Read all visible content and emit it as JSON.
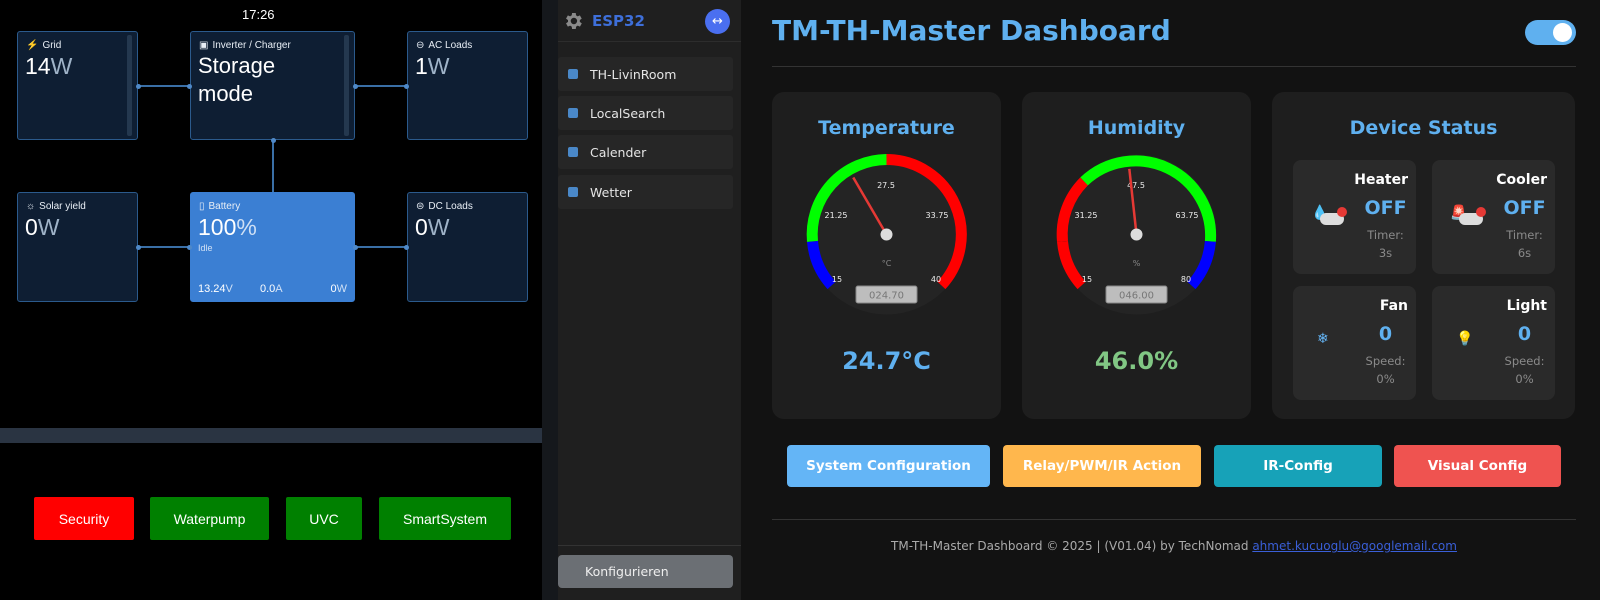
{
  "victron": {
    "clock": "17:26",
    "grid": {
      "label": "Grid",
      "value": "14",
      "unit": "W"
    },
    "inverter": {
      "label": "Inverter / Charger",
      "line1": "Storage",
      "line2": "mode"
    },
    "ac_loads": {
      "label": "AC Loads",
      "value": "1",
      "unit": "W"
    },
    "solar": {
      "label": "Solar yield",
      "value": "0",
      "unit": "W"
    },
    "battery": {
      "label": "Battery",
      "value": "100",
      "unit": "%",
      "state": "Idle",
      "voltage": "13.24",
      "voltage_unit": "V",
      "current": "0.0",
      "current_unit": "A",
      "power": "0",
      "power_unit": "W"
    },
    "dc_loads": {
      "label": "DC Loads",
      "value": "0",
      "unit": "W"
    },
    "buttons": [
      {
        "label": "Security",
        "color": "#ff0000"
      },
      {
        "label": "Waterpump",
        "color": "#008000"
      },
      {
        "label": "UVC",
        "color": "#008000"
      },
      {
        "label": "SmartSystem",
        "color": "#008000"
      }
    ]
  },
  "sidebar": {
    "brand": "ESP32",
    "items": [
      {
        "label": "TH-LivinRoom",
        "icon": "document-icon"
      },
      {
        "label": "LocalSearch",
        "icon": "folder-icon"
      },
      {
        "label": "Calender",
        "icon": "calendar-icon"
      },
      {
        "label": "Wetter",
        "icon": "folder-icon"
      }
    ],
    "configure": "Konfigurieren"
  },
  "dashboard": {
    "title": "TM-TH-Master Dashboard",
    "temperature": {
      "title": "Temperature",
      "ticks": [
        "15",
        "21.25",
        "27.5",
        "33.75",
        "40"
      ],
      "unit": "°C",
      "display": "024.70",
      "reading": "24.7°C",
      "value": 24.7,
      "min": 15,
      "max": 40
    },
    "humidity": {
      "title": "Humidity",
      "ticks": [
        "15",
        "31.25",
        "47.5",
        "63.75",
        "80"
      ],
      "unit": "%",
      "display": "046.00",
      "reading": "46.0%",
      "value": 46.0,
      "min": 15,
      "max": 80
    },
    "device_status": {
      "title": "Device Status",
      "devices": [
        {
          "name": "Heater",
          "state": "OFF",
          "sub_label": "Timer:",
          "sub_value": "3s",
          "icon": "water-drop-icon"
        },
        {
          "name": "Cooler",
          "state": "OFF",
          "sub_label": "Timer:",
          "sub_value": "6s",
          "icon": "alarm-light-icon"
        },
        {
          "name": "Fan",
          "state": "0",
          "sub_label": "Speed:",
          "sub_value": "0%",
          "icon": "snowflake-icon"
        },
        {
          "name": "Light",
          "state": "0",
          "sub_label": "Speed:",
          "sub_value": "0%",
          "icon": "light-bulb-icon"
        }
      ]
    },
    "actions": [
      {
        "label": "System Configuration",
        "color": "#64b5f6"
      },
      {
        "label": "Relay/PWM/IR Action",
        "color": "#ffb74d"
      },
      {
        "label": "IR-Config",
        "color": "#17a2b8"
      },
      {
        "label": "Visual Config",
        "color": "#ef5350"
      }
    ],
    "footer": {
      "text": "TM-TH-Master Dashboard © 2025 | (V01.04) by TechNomad",
      "email": "ahmet.kucuoglu@googlemail.com"
    }
  }
}
